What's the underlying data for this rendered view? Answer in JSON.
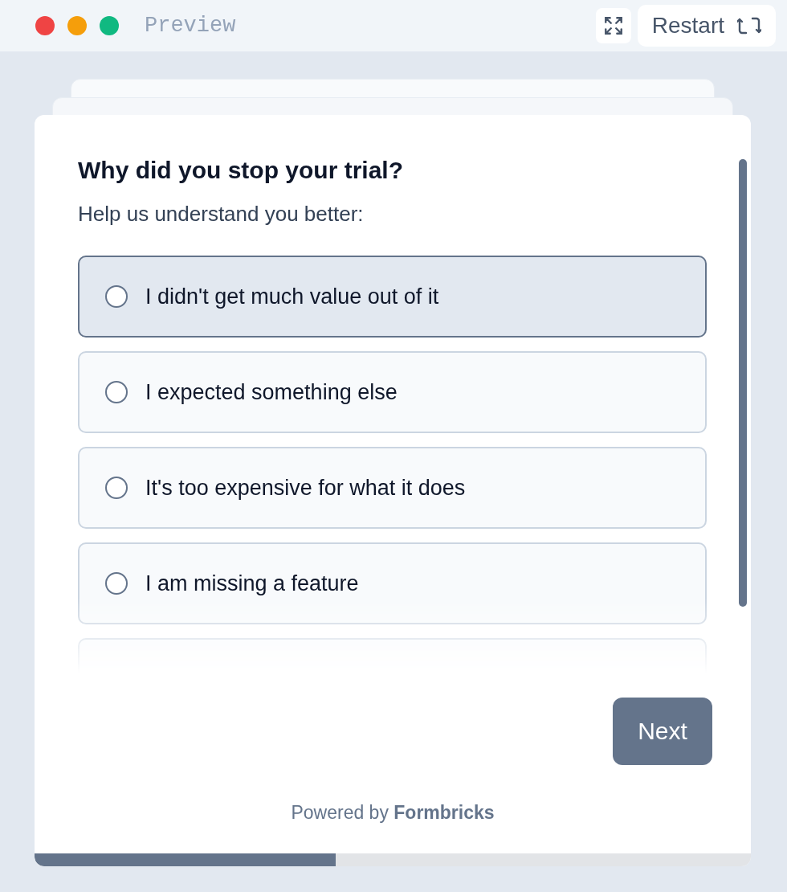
{
  "window": {
    "title": "Preview",
    "dots": [
      {
        "color": "#ef4444"
      },
      {
        "color": "#f59e0b"
      },
      {
        "color": "#10b981"
      }
    ]
  },
  "toolbar": {
    "restart": "Restart"
  },
  "survey": {
    "question": "Why did you stop your trial?",
    "subheader": "Help us understand you better:",
    "choices": [
      {
        "label": "I didn't get much value out of it",
        "selected": false,
        "highlighted": true
      },
      {
        "label": "I expected something else",
        "selected": false,
        "highlighted": false
      },
      {
        "label": "It's too expensive for what it does",
        "selected": false,
        "highlighted": false
      },
      {
        "label": "I am missing a feature",
        "selected": false,
        "highlighted": false
      }
    ],
    "next": "Next",
    "powered_prefix": "Powered by",
    "powered_brand": "Formbricks",
    "progress": {
      "level": 0.42
    }
  }
}
